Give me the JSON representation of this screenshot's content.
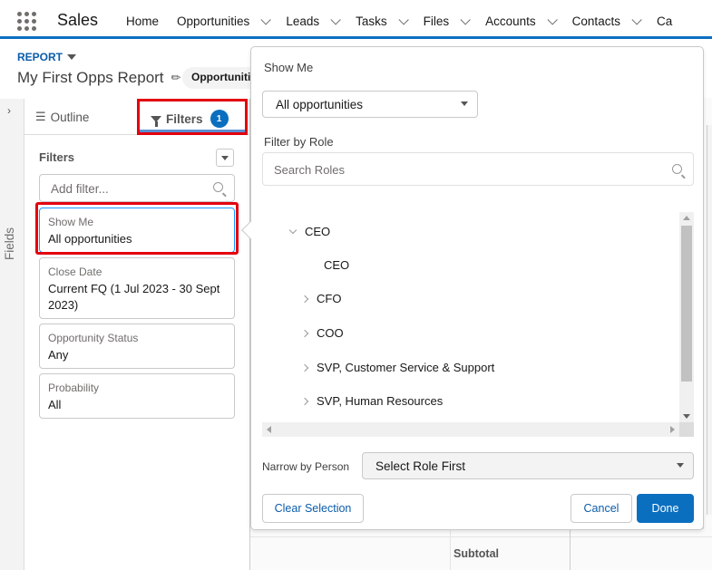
{
  "topbar": {
    "app_name": "Sales",
    "nav": [
      {
        "label": "Home",
        "has_menu": false
      },
      {
        "label": "Opportunities",
        "has_menu": true
      },
      {
        "label": "Leads",
        "has_menu": true
      },
      {
        "label": "Tasks",
        "has_menu": true
      },
      {
        "label": "Files",
        "has_menu": true
      },
      {
        "label": "Accounts",
        "has_menu": true
      },
      {
        "label": "Contacts",
        "has_menu": true
      },
      {
        "label": "Ca",
        "has_menu": false
      }
    ],
    "accent_color": "#0b6fc0"
  },
  "header": {
    "object_label": "REPORT",
    "report_title": "My First Opps Report",
    "report_type_pill": "Opportunities"
  },
  "fields_rail": {
    "label": "Fields"
  },
  "panel": {
    "tabs": {
      "outline": "Outline",
      "filters": "Filters",
      "filters_count": "1"
    },
    "filters_heading": "Filters",
    "add_filter_placeholder": "Add filter...",
    "filters": [
      {
        "label": "Show Me",
        "value": "All opportunities"
      },
      {
        "label": "Close Date",
        "value": "Current FQ (1 Jul 2023 - 30 Sept 2023)"
      },
      {
        "label": "Opportunity Status",
        "value": "Any"
      },
      {
        "label": "Probability",
        "value": "All"
      }
    ]
  },
  "popover": {
    "title": "Show Me",
    "show_select_value": "All opportunities",
    "filter_by_role_label": "Filter by Role",
    "search_roles_placeholder": "Search Roles",
    "role_tree": [
      {
        "label": "CEO",
        "expanded": true,
        "level": 0
      },
      {
        "label": "CEO",
        "leaf": true,
        "level": 1
      },
      {
        "label": "CFO",
        "expanded": false,
        "level": 1
      },
      {
        "label": "COO",
        "expanded": false,
        "level": 1
      },
      {
        "label": "SVP, Customer Service & Support",
        "expanded": false,
        "level": 1
      },
      {
        "label": "SVP, Human Resources",
        "expanded": false,
        "level": 1
      }
    ],
    "narrow_by_person_label": "Narrow by Person",
    "narrow_select_value": "Select Role First",
    "buttons": {
      "clear": "Clear Selection",
      "cancel": "Cancel",
      "done": "Done"
    }
  },
  "background_table": {
    "subtotal_label": "Subtotal"
  }
}
